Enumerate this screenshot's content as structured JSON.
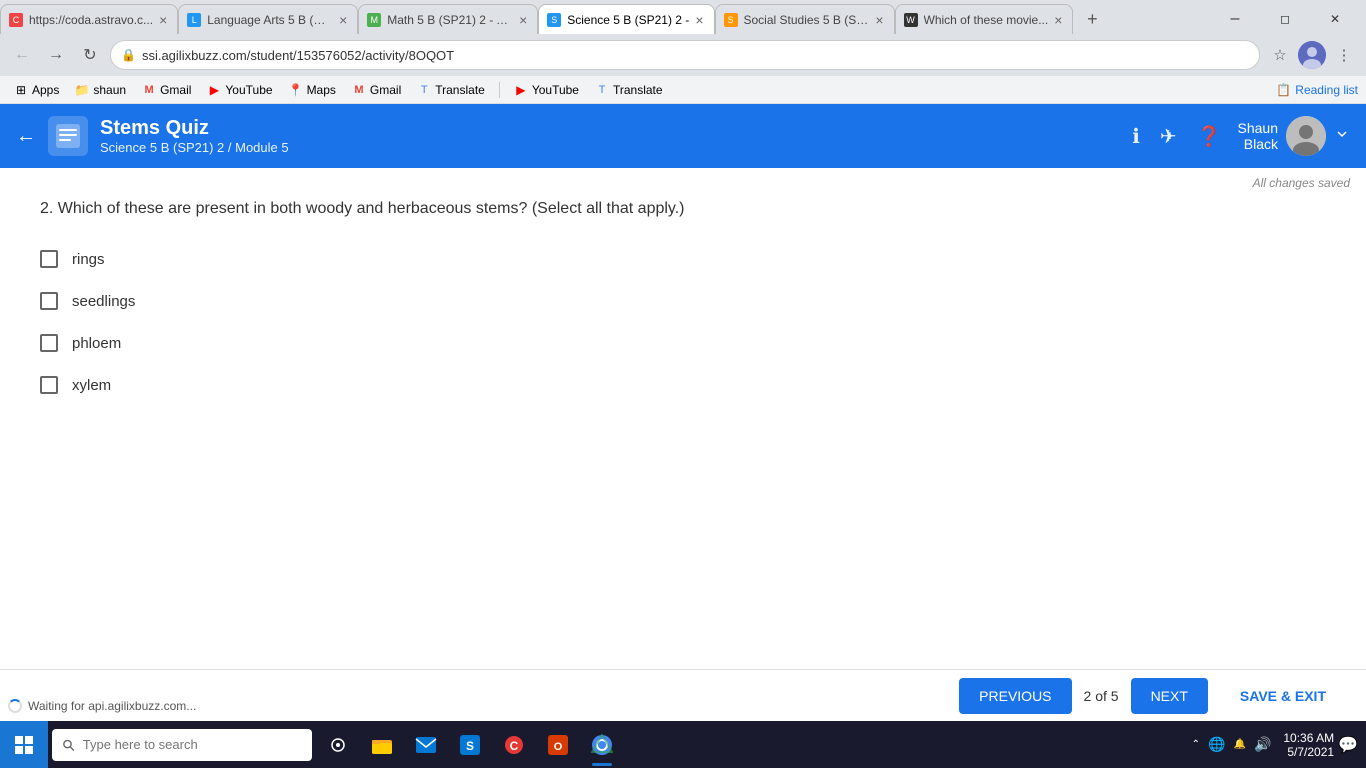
{
  "browser": {
    "tabs": [
      {
        "id": "astravo",
        "title": "https://coda.astravo.c...",
        "icon": "🔴",
        "active": false,
        "colorClass": "tab-astravo"
      },
      {
        "id": "lang",
        "title": "Language Arts 5 B (SP...",
        "icon": "📘",
        "active": false,
        "colorClass": "tab-lang"
      },
      {
        "id": "math",
        "title": "Math 5 B (SP21) 2 - Ac...",
        "icon": "📗",
        "active": false,
        "colorClass": "tab-math"
      },
      {
        "id": "science",
        "title": "Science 5 B (SP21) 2 -",
        "icon": "📘",
        "active": true,
        "colorClass": "tab-science"
      },
      {
        "id": "social",
        "title": "Social Studies 5 B (SP...",
        "icon": "📙",
        "active": false,
        "colorClass": "tab-social"
      },
      {
        "id": "movie",
        "title": "Which of these movie...",
        "icon": "🎬",
        "active": false,
        "colorClass": "tab-movie"
      }
    ],
    "address": "ssi.agilixbuzz.com/student/153576052/activity/8OQOT",
    "bookmarks": [
      {
        "label": "Apps",
        "icon": "⊞"
      },
      {
        "label": "shaun",
        "icon": "📁"
      },
      {
        "label": "Gmail",
        "icon": "M"
      },
      {
        "label": "YouTube",
        "icon": "▶"
      },
      {
        "label": "Maps",
        "icon": "📍"
      },
      {
        "label": "Gmail",
        "icon": "M"
      },
      {
        "label": "Translate",
        "icon": "🔤"
      },
      {
        "label": "YouTube",
        "icon": "▶"
      },
      {
        "label": "Translate",
        "icon": "🔤"
      }
    ],
    "reading_list_label": "Reading list"
  },
  "app_header": {
    "title": "Stems Quiz",
    "subtitle": "Science 5 B (SP21) 2 / Module 5",
    "user_first": "Shaun",
    "user_last": "Black",
    "status": "All changes saved"
  },
  "question": {
    "number": "2.",
    "text": "2. Which of these are present in both woody and herbaceous stems? (Select all that apply.)",
    "answers": [
      {
        "id": "rings",
        "label": "rings",
        "checked": false
      },
      {
        "id": "seedlings",
        "label": "seedlings",
        "checked": false
      },
      {
        "id": "phloem",
        "label": "phloem",
        "checked": false
      },
      {
        "id": "xylem",
        "label": "xylem",
        "checked": false
      }
    ]
  },
  "navigation": {
    "previous_label": "PREVIOUS",
    "next_label": "NEXT",
    "save_exit_label": "SAVE & EXIT",
    "page_current": 2,
    "page_total": 5,
    "page_indicator": "2 of 5"
  },
  "footer": {
    "waiting_msg": "Waiting for api.agilixbuzz.com..."
  },
  "taskbar": {
    "search_placeholder": "Type here to search",
    "time": "10:36 AM",
    "date": "5/7/2021"
  }
}
